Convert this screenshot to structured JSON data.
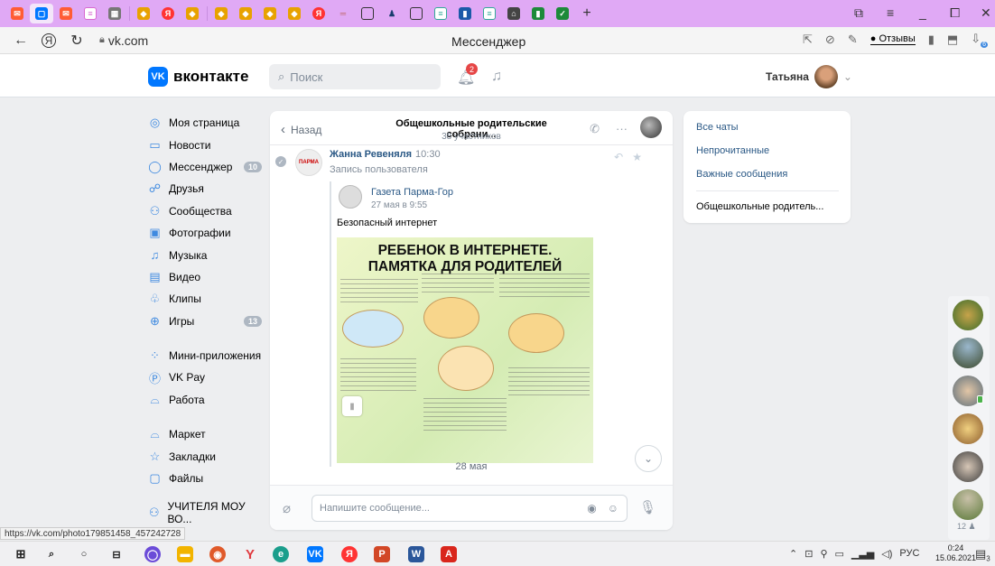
{
  "browser": {
    "page_title": "Мессенджер",
    "url": "vk.com",
    "feedback_label": "Отзывы",
    "tab_count_badge": "6"
  },
  "header": {
    "logo_text": "вконтакте",
    "search_placeholder": "Поиск",
    "notifications_badge": "2",
    "user_name": "Татьяна"
  },
  "leftnav": {
    "items": [
      {
        "label": "Моя страница",
        "icon": "user-circle-icon",
        "count": ""
      },
      {
        "label": "Новости",
        "icon": "news-icon",
        "count": ""
      },
      {
        "label": "Мессенджер",
        "icon": "message-icon",
        "count": "10"
      },
      {
        "label": "Друзья",
        "icon": "friends-icon",
        "count": ""
      },
      {
        "label": "Сообщества",
        "icon": "communities-icon",
        "count": ""
      },
      {
        "label": "Фотографии",
        "icon": "photos-icon",
        "count": ""
      },
      {
        "label": "Музыка",
        "icon": "music-icon",
        "count": ""
      },
      {
        "label": "Видео",
        "icon": "video-icon",
        "count": ""
      },
      {
        "label": "Клипы",
        "icon": "clips-icon",
        "count": ""
      },
      {
        "label": "Игры",
        "icon": "games-icon",
        "count": "13"
      }
    ],
    "items2": [
      {
        "label": "Мини-приложения",
        "icon": "mini-apps-icon"
      },
      {
        "label": "VK Pay",
        "icon": "vkpay-icon"
      },
      {
        "label": "Работа",
        "icon": "work-icon"
      }
    ],
    "items3": [
      {
        "label": "Маркет",
        "icon": "market-icon"
      },
      {
        "label": "Закладки",
        "icon": "bookmarks-icon"
      },
      {
        "label": "Файлы",
        "icon": "files-icon"
      }
    ],
    "group_label": "УЧИТЕЛЯ МОУ ВО..."
  },
  "chat": {
    "back_label": "Назад",
    "title": "Общешкольные родительские собрани...",
    "subtitle": "38 участников",
    "message": {
      "sender": "Жанна Ревеняля",
      "time": "10:30",
      "record_label": "Запись пользователя",
      "repost_group": "Газета Парма-Гор",
      "repost_date": "27 мая в 9:55",
      "repost_text": "Безопасный интернет",
      "poster_title_1": "РЕБЕНОК В ИНТЕРНЕТЕ.",
      "poster_title_2": "ПАМЯТКА ДЛЯ РОДИТЕЛЕЙ"
    },
    "date_separator": "28 мая",
    "input_placeholder": "Напишите сообщение..."
  },
  "rightpanel": {
    "all_chats": "Все чаты",
    "unread": "Непрочитанные",
    "important": "Важные сообщения",
    "current_chat": "Общешкольные родитель..."
  },
  "rightcol": {
    "count": "12"
  },
  "status_url": "https://vk.com/photo179851458_457242728",
  "taskbar": {
    "lang": "РУС",
    "time": "0:24",
    "date": "15.06.2021",
    "notif_count": "3"
  }
}
